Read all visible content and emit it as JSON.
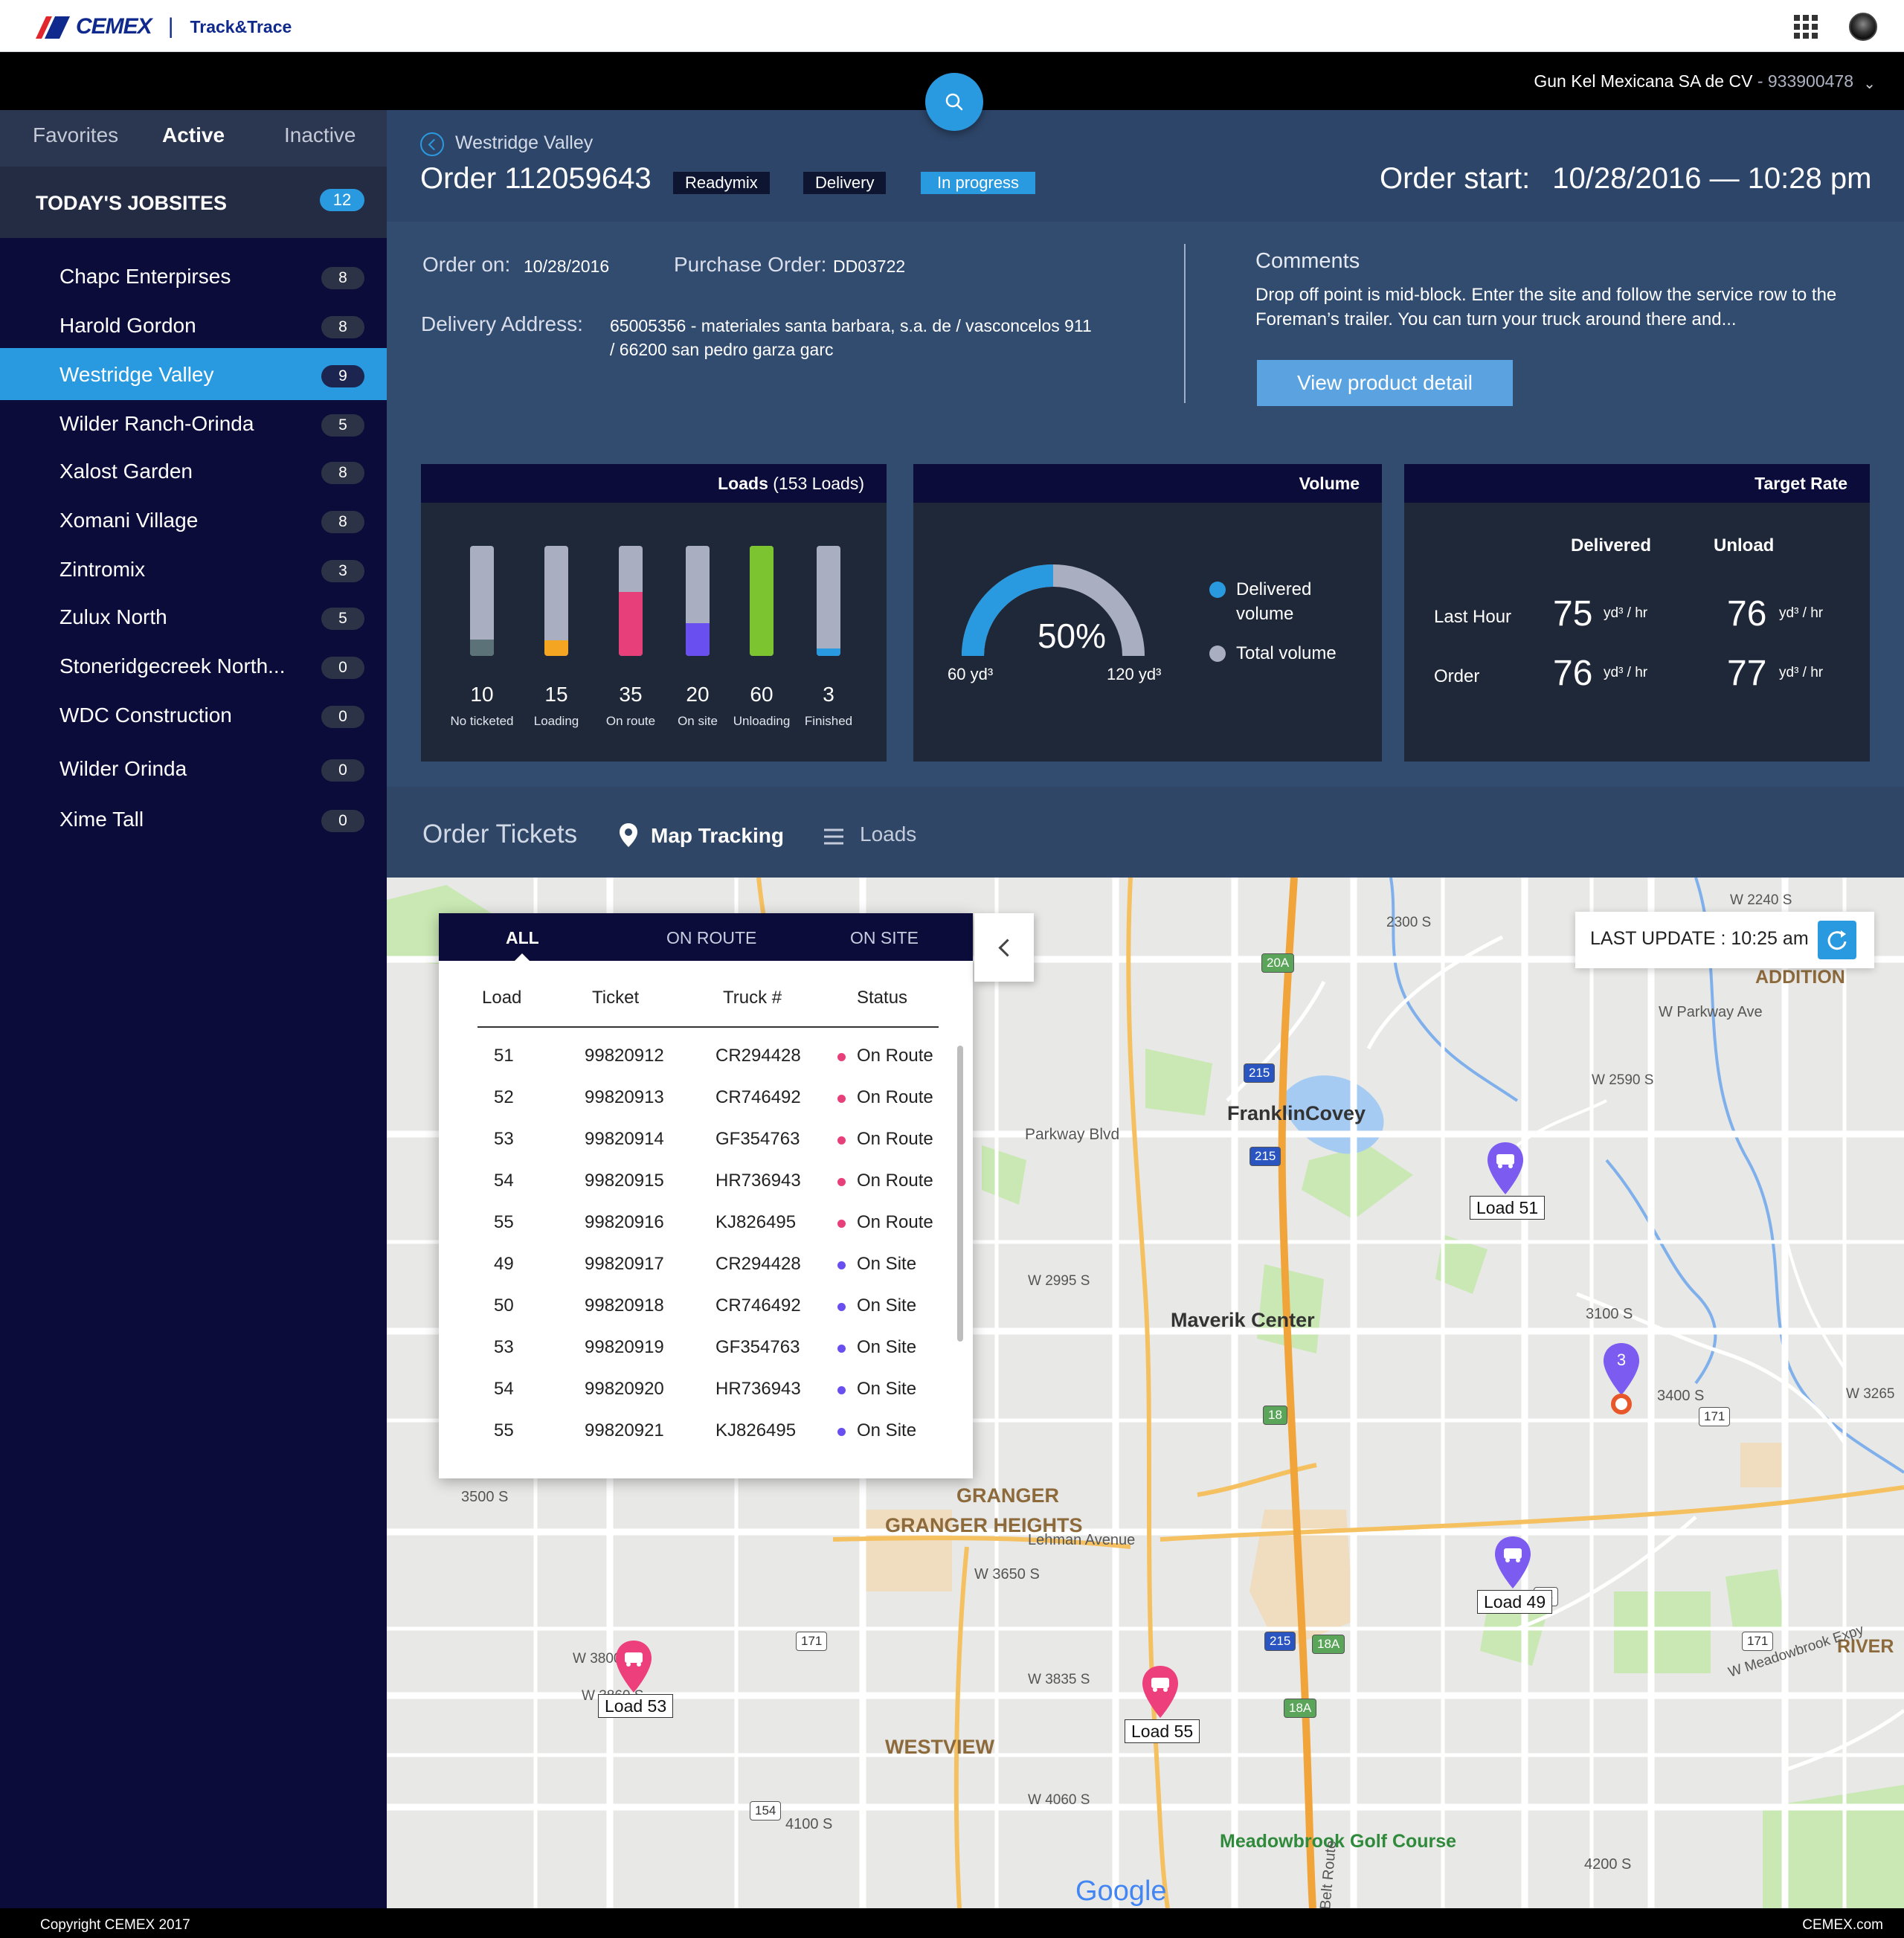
{
  "app": {
    "brand": "CEMEX",
    "name": "Track&Trace"
  },
  "account": {
    "company": "Gun Kel Mexicana SA de CV",
    "id": "- 933900478"
  },
  "sidebar": {
    "tabs": [
      "Favorites",
      "Active",
      "Inactive"
    ],
    "active_tab": "Active",
    "todays_label": "TODAY'S JOBSITES",
    "todays_count": "12",
    "jobsites": [
      {
        "name": "Chapc Enterpirses",
        "count": "8"
      },
      {
        "name": "Harold Gordon",
        "count": "8"
      },
      {
        "name": "Westridge Valley",
        "count": "9",
        "selected": true
      },
      {
        "name": "Wilder Ranch-Orinda",
        "count": "5"
      },
      {
        "name": "Xalost Garden",
        "count": "8"
      },
      {
        "name": "Xomani Village",
        "count": "8"
      },
      {
        "name": "Zintromix",
        "count": "3"
      },
      {
        "name": "Zulux North",
        "count": "5"
      },
      {
        "name": "Stoneridgecreek North...",
        "count": "0"
      },
      {
        "name": "WDC Construction",
        "count": "0"
      },
      {
        "name": "Wilder Orinda",
        "count": "0"
      },
      {
        "name": "Xime Tall",
        "count": "0"
      }
    ]
  },
  "order": {
    "breadcrumb": "Westridge Valley",
    "title": "Order 112059643",
    "tags": [
      "Readymix",
      "Delivery",
      "In progress"
    ],
    "start_label": "Order start:",
    "start_value": "10/28/2016 — 10:28 pm",
    "order_on_label": "Order on:",
    "order_on_value": "10/28/2016",
    "po_label": "Purchase Order:",
    "po_value": "DD03722",
    "address_label": "Delivery Address:",
    "address_line1": "65005356 - materiales santa barbara, s.a. de / vasconcelos 911",
    "address_line2": "/ 66200 san pedro garza garc",
    "comments_title": "Comments",
    "comments_text": "Drop off point is mid-block. Enter the site and follow the service row to the Foreman’s trailer. You can turn your truck around there and...",
    "product_button": "View product detail"
  },
  "loads_card": {
    "title": "Loads",
    "subtitle": "(153 Loads)",
    "bars": [
      {
        "value": "10",
        "label": "No ticketed",
        "fill": 0.15,
        "color": "#5a7278"
      },
      {
        "value": "15",
        "label": "Loading",
        "fill": 0.14,
        "color": "#f4a623"
      },
      {
        "value": "35",
        "label": "On route",
        "fill": 0.58,
        "color": "#e73f7a"
      },
      {
        "value": "20",
        "label": "On site",
        "fill": 0.3,
        "color": "#6a4ff0"
      },
      {
        "value": "60",
        "label": "Unloading",
        "fill": 1.0,
        "color": "#7cc531"
      },
      {
        "value": "3",
        "label": "Finished",
        "fill": 0.07,
        "color": "#2a9ae0"
      }
    ]
  },
  "volume_card": {
    "title": "Volume",
    "percent_value": 50,
    "percent": "50%",
    "min": "60 yd³",
    "max": "120 yd³",
    "legend": [
      {
        "label": "Delivered volume",
        "color": "#2a9ae0"
      },
      {
        "label": "Total volume",
        "color": "#a9aec0"
      }
    ]
  },
  "target_rate_card": {
    "title": "Target Rate",
    "col_delivered": "Delivered",
    "col_unload": "Unload",
    "rows": [
      {
        "label": "Last Hour",
        "delivered": "75",
        "unload": "76"
      },
      {
        "label": "Order",
        "delivered": "76",
        "unload": "77"
      }
    ],
    "unit": "yd³ / hr"
  },
  "tabs": {
    "order_tickets": "Order Tickets",
    "map_tracking": "Map Tracking",
    "loads": "Loads"
  },
  "panel": {
    "tabs": [
      "ALL",
      "ON ROUTE",
      "ON SITE"
    ],
    "headers": [
      "Load",
      "Ticket",
      "Truck #",
      "Status"
    ],
    "rows": [
      {
        "load": "51",
        "ticket": "99820912",
        "truck": "CR294428",
        "status": "On Route"
      },
      {
        "load": "52",
        "ticket": "99820913",
        "truck": "CR746492",
        "status": "On Route"
      },
      {
        "load": "53",
        "ticket": "99820914",
        "truck": "GF354763",
        "status": "On Route"
      },
      {
        "load": "54",
        "ticket": "99820915",
        "truck": "HR736943",
        "status": "On Route"
      },
      {
        "load": "55",
        "ticket": "99820916",
        "truck": "KJ826495",
        "status": "On Route"
      },
      {
        "load": "49",
        "ticket": "99820917",
        "truck": "CR294428",
        "status": "On Site"
      },
      {
        "load": "50",
        "ticket": "99820918",
        "truck": "CR746492",
        "status": "On Site"
      },
      {
        "load": "53",
        "ticket": "99820919",
        "truck": "GF354763",
        "status": "On Site"
      },
      {
        "load": "54",
        "ticket": "99820920",
        "truck": "HR736943",
        "status": "On Site"
      },
      {
        "load": "55",
        "ticket": "99820921",
        "truck": "KJ826495",
        "status": "On Site"
      }
    ],
    "status_colors": {
      "On Route": "#e73f7a",
      "On Site": "#6a4ff0"
    }
  },
  "map": {
    "last_update": "LAST UPDATE : 10:25 am",
    "pins": [
      {
        "label": "Load 51",
        "kind": "site"
      },
      {
        "label": "Load 49",
        "kind": "site"
      },
      {
        "label": "Load 53",
        "kind": "route"
      },
      {
        "label": "Load 55",
        "kind": "route"
      },
      {
        "label": "3",
        "kind": "cluster"
      }
    ],
    "labels": [
      "FranklinCovey",
      "Maverik Center",
      "GRANGER",
      "GRANGER HEIGHTS",
      "WESTVIEW",
      "Meadowbrook Golf Course",
      "ADDITION",
      "RIVER",
      "Parkway Blvd",
      "W Parkway Ave",
      "Lehman Avenue",
      "W 3650 S",
      "W 3800 S",
      "W 3860 S",
      "W 3835 S",
      "W 4060 S",
      "4100 S",
      "4200 S",
      "3500 S",
      "3100 S",
      "3400 S",
      "2300 S",
      "W 2240 S",
      "W 2590 S",
      "W 2995 S",
      "W 3265",
      "W Meadowbrook Expy",
      "Belt Route",
      "Google"
    ],
    "shields": [
      "20A",
      "215",
      "215",
      "18",
      "215",
      "18A",
      "18A",
      "171",
      "171",
      "171",
      "68",
      "154"
    ]
  },
  "footer": {
    "copyright": "Copyright CEMEX 2017",
    "site": "CEMEX.com"
  }
}
